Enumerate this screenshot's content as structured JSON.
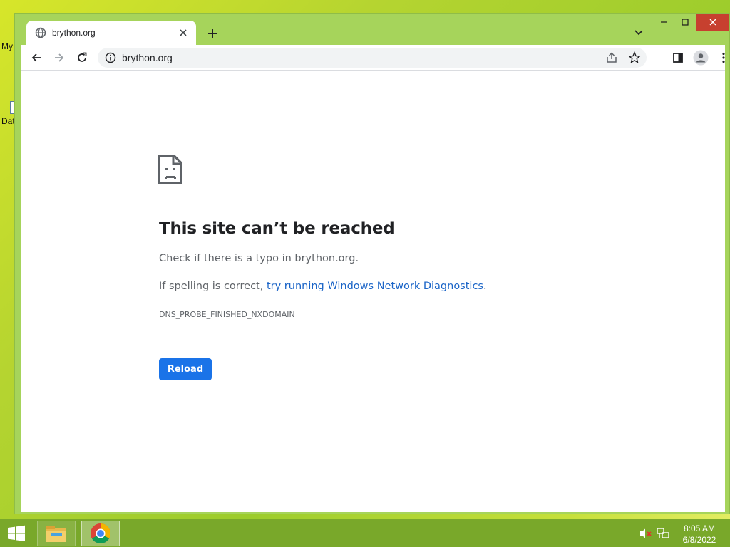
{
  "desktop": {
    "labels": [
      "My",
      "Dat"
    ]
  },
  "browser": {
    "tab": {
      "title": "brython.org",
      "favicon": "globe-icon"
    },
    "omnibox": {
      "url": "brython.org"
    },
    "window_controls": {
      "close_color": "#c7402f"
    }
  },
  "error_page": {
    "title": "This site can’t be reached",
    "line1": "Check if there is a typo in brython.org.",
    "line2_prefix": "If spelling is correct, ",
    "line2_link": "try running Windows Network Diagnostics",
    "line2_suffix": ".",
    "error_code": "DNS_PROBE_FINISHED_NXDOMAIN",
    "reload_label": "Reload"
  },
  "taskbar": {
    "apps": [
      "file-explorer-icon",
      "chrome-icon"
    ],
    "tray": [
      "volume-muted-icon",
      "network-icon"
    ],
    "clock": {
      "time": "8:05 AM",
      "date": "6/8/2022"
    }
  },
  "colors": {
    "accent": "#1a73e8",
    "link": "#1a64c7",
    "frame": "#a6d45b",
    "taskbar": "#79a82a"
  }
}
